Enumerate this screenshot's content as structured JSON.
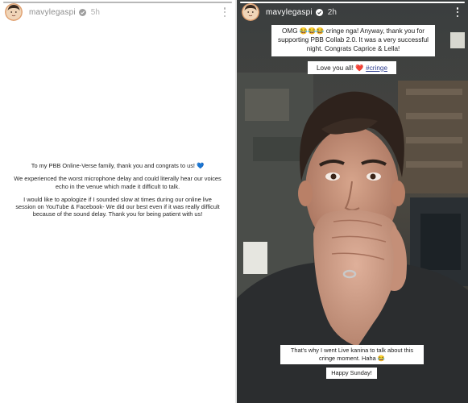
{
  "left_story": {
    "username": "mavylegaspi",
    "time": "5h",
    "progress": 1.0,
    "paragraphs": [
      "To my PBB Online-Verse family, thank you and congrats to us! 💙",
      "We experienced the worst microphone delay and could literally hear our voices echo in the venue which made it difficult to talk.",
      "I would like to apologize if I sounded slow at times during our online live session on YouTube & Facebook- We did our best even if it was really difficult because of the sound delay. Thank you for being patient with us!"
    ]
  },
  "right_story": {
    "username": "mavylegaspi",
    "time": "2h",
    "progress": 1.0,
    "caption_top": "OMG 😂😂😂 cringe nga! Anyway, thank you for supporting PBB Collab 2.0. It was a very successful night. Congrats Caprice & Lella!",
    "caption_love_text": "Love you all!",
    "caption_love_emoji": "❤️",
    "caption_hashtag": "#cringe",
    "caption_bottom": "That's why I went Live kanina to talk about this cringe moment. Haha 😂",
    "caption_sunday": "Happy Sunday!"
  },
  "icons": {
    "verified": "verified-badge-icon",
    "more": "more-options-icon"
  },
  "colors": {
    "verified_blue": "#3897f0",
    "hashtag_blue": "#2d3d8f"
  }
}
